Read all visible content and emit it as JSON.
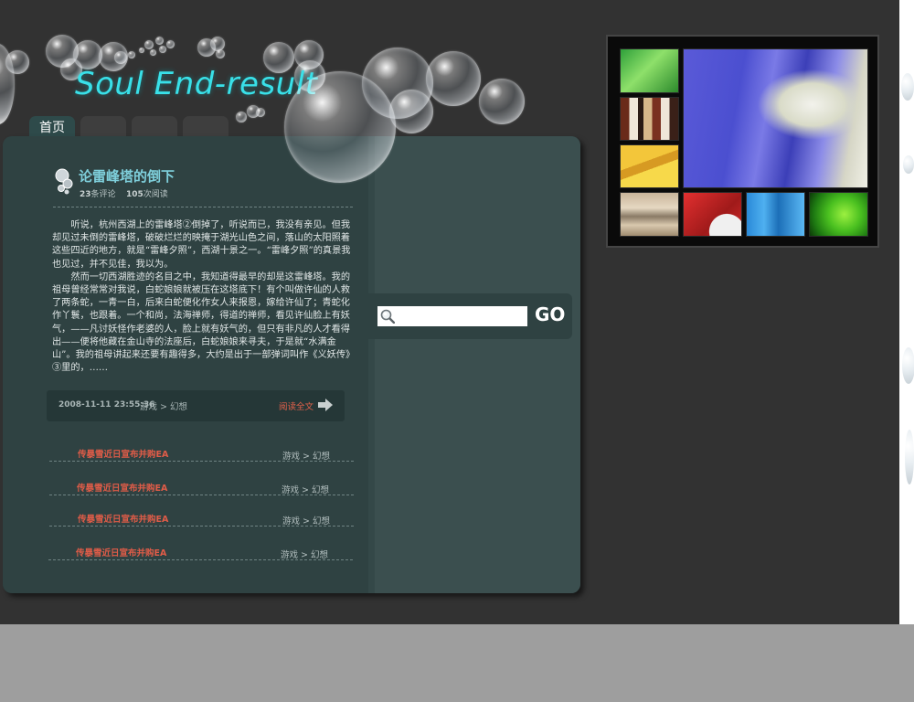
{
  "site": {
    "title": "Soul End-result"
  },
  "nav": {
    "tabs": [
      {
        "label": "首页"
      },
      {
        "label": ""
      },
      {
        "label": ""
      },
      {
        "label": ""
      }
    ]
  },
  "post": {
    "title": "论雷峰塔的倒下",
    "comments_count": "23",
    "comments_suffix": "条评论",
    "reads_count": "105",
    "reads_suffix": "次阅读",
    "paragraphs": [
      "听说，杭州西湖上的雷峰塔②倒掉了，听说而已，我没有亲见。但我却见过未倒的雷峰塔，破破烂烂的映掩于湖光山色之间，落山的太阳照着这些四近的地方，就是“雷峰夕照”，西湖十景之一。“雷峰夕照”的真景我也见过，并不见佳，我以为。",
      "然而一切西湖胜迹的名目之中，我知道得最早的却是这雷峰塔。我的祖母曾经常常对我说，白蛇娘娘就被压在这塔底下！有个叫做许仙的人救了两条蛇，一青一白，后来白蛇便化作女人来报恩，嫁给许仙了；青蛇化作丫鬟，也跟着。一个和尚，法海禅师，得道的禅师，看见许仙脸上有妖气，——凡讨妖怪作老婆的人，脸上就有妖气的，但只有非凡的人才看得出——便将他藏在金山寺的法座后，白蛇娘娘来寻夫，于是就“水满金山”。我的祖母讲起来还要有趣得多，大约是出于一部弹词叫作《义妖传》③里的，……"
    ],
    "date": "2008-11-11 23:55:36",
    "category": "游戏 > 幻想",
    "read_more": "阅读全文"
  },
  "list": {
    "items": [
      {
        "title": "传暴雪近日宣布并购EA",
        "category": "游戏 > 幻想"
      },
      {
        "title": "传暴雪近日宣布并购EA",
        "category": "游戏 > 幻想"
      },
      {
        "title": "传暴雪近日宣布并购EA",
        "category": "游戏 > 幻想"
      },
      {
        "title": "传暴雪近日宣布并购EA",
        "category": "游戏 > 幻想"
      }
    ]
  },
  "search": {
    "placeholder": "",
    "button_label": "GO"
  },
  "icons": {
    "post": "bubbles-icon",
    "search": "magnifier-icon",
    "more": "arrow-right-icon"
  },
  "colors": {
    "title_cyan": "#39e0e8",
    "link_red": "#e05c48",
    "panel": "#2f4242"
  }
}
